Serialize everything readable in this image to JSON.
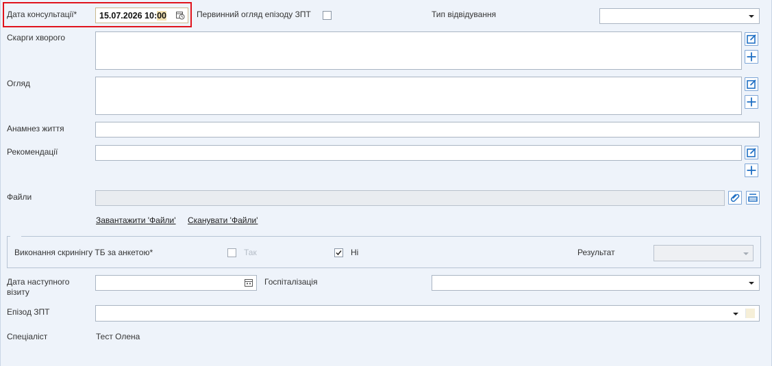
{
  "consultation_date": {
    "label": "Дата консультації*",
    "value_main": "15.07.2026 10:",
    "value_min": "00"
  },
  "first_exam": {
    "label": "Первинний огляд епізоду ЗПТ",
    "checked": false
  },
  "visit_type": {
    "label": "Тип відвідування",
    "value": ""
  },
  "complaints": {
    "label": "Скарги хворого",
    "value": ""
  },
  "examination": {
    "label": "Огляд",
    "value": ""
  },
  "anamnesis": {
    "label": "Анамнез життя",
    "value": ""
  },
  "recommendations": {
    "label": "Рекомендації",
    "value": ""
  },
  "files": {
    "label": "Файли",
    "upload_link": "Завантажити 'Файли'",
    "scan_link": "Сканувати 'Файли'"
  },
  "screening": {
    "label": "Виконання скринінгу ТБ за анкетою*",
    "yes_label": "Так",
    "yes_checked": false,
    "no_label": "Ні",
    "no_checked": true,
    "result_label": "Результат",
    "result_value": ""
  },
  "next_visit": {
    "label_line1": "Дата наступного",
    "label_line2": "візиту",
    "value": ""
  },
  "hospitalization": {
    "label": "Госпіталізація",
    "value": ""
  },
  "episode": {
    "label": "Епізод ЗПТ",
    "value": ""
  },
  "specialist": {
    "label": "Спеціаліст",
    "value": "Тест Олена"
  },
  "colors": {
    "highlight": "#e0121b",
    "accent_border": "#7da5d6",
    "background": "#eef3fa"
  }
}
